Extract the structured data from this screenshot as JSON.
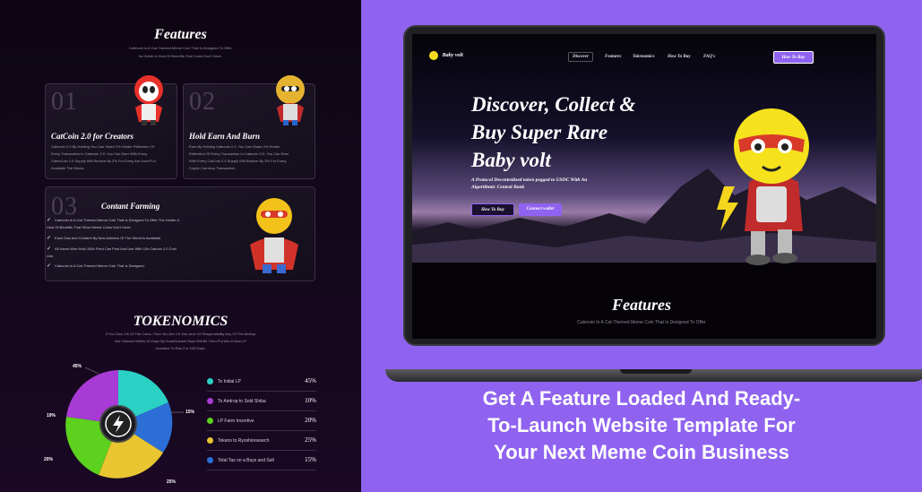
{
  "features_section": {
    "title": "Features",
    "subtitle_line1": "Catecoin Is A Cat-Themed Meme Coin That Is Designed To Offer",
    "subtitle_line2": "Its Holder A Host Of Benefits That Coins Don't Have."
  },
  "cards": [
    {
      "num": "01",
      "title": "CatCoin 2.0 for Creators",
      "desc": [
        "Catecoin 2.0 By Holding You Can Share 2% Holder Reflection Of",
        "Every Transaction In Catecoin 2.0. You Can Earn With Every",
        "CatecCoin 2.0 Supply Will Reduce By 2% For Every Are Used For",
        "Available The Works."
      ]
    },
    {
      "num": "02",
      "title": "Hold Earn And Burn",
      "desc": [
        "Earn By Holding Catecoin 2.0. You Can Share 2% Holder",
        "Reflection Of Every Transaction In Catecoin 2.0. You Can Earn",
        "With Every CatCoin 2.0 Supply Will Reduce By 2% For Every",
        "Crypto Currency Transaction."
      ]
    },
    {
      "num": "03",
      "title": "Contant Farming"
    }
  ],
  "farming_points": [
    "Catecoin Is A Cat-Themed Meme Coin That Is Designed To Offer The Holder A Host Of Benefits That Other Meme Coins Don't Have.",
    "Each Gas And Cointent By New Address Of The World Is Available.",
    "All Users Who Hold 100k Point Can Post And Use With 10x Catcoin 2.0 Coin Like.",
    "Catecoin Is A Cat-Themed Meme Coin That Is Designed."
  ],
  "tokenomics": {
    "title": "TOKENOMICS",
    "desc": [
      "If You Own 1% Of The Coins, Then You Are 1% Dev And 1% Responsibility Any Of The Airdrop",
      "Not Claimed Within 45 Days By SolaVKaranil Boys Will Be Then Put Into A New LP",
      "Incentive To Run For 100 Days."
    ],
    "rows": [
      {
        "label": "To Initial LP",
        "pct": "45%",
        "color": "#2bd1c4"
      },
      {
        "label": "To Airdrop to Sold Shiba",
        "pct": "10%",
        "color": "#a83bd6"
      },
      {
        "label": "LP Farm Incentive",
        "pct": "20%",
        "color": "#5cd11e"
      },
      {
        "label": "Tokens to Ryoshiresearch",
        "pct": "25%",
        "color": "#e9c531"
      },
      {
        "label": "Total Tax on a Buys and Sell",
        "pct": "15%",
        "color": "#2b6fd6"
      }
    ],
    "pie_labels": {
      "a": "45%",
      "b": "15%",
      "c": "19%",
      "d": "20%",
      "e": "25%"
    }
  },
  "site": {
    "logo_text": "Baby volt",
    "nav": [
      "Discover",
      "Features",
      "Tokenomics",
      "How To Buy",
      "FAQ's"
    ],
    "nav_cta": "How To Buy",
    "hero_title": [
      "Discover, Collect &",
      "Buy Super Rare",
      "Baby volt"
    ],
    "hero_sub": [
      "A Protocol Decentralized token pegged to USDC With An",
      "Algorithmic Central Bank"
    ],
    "cta_primary": "How To Buy",
    "cta_secondary": "Connect wallet",
    "features_title": "Features",
    "features_sub": "Catecoin Is A Cat-Themed Meme Coin That Is Designed To Offer"
  },
  "promo": [
    "Get A Feature Loaded And Ready-",
    "To-Launch Website Template For",
    "Your Next Meme Coin Business"
  ]
}
